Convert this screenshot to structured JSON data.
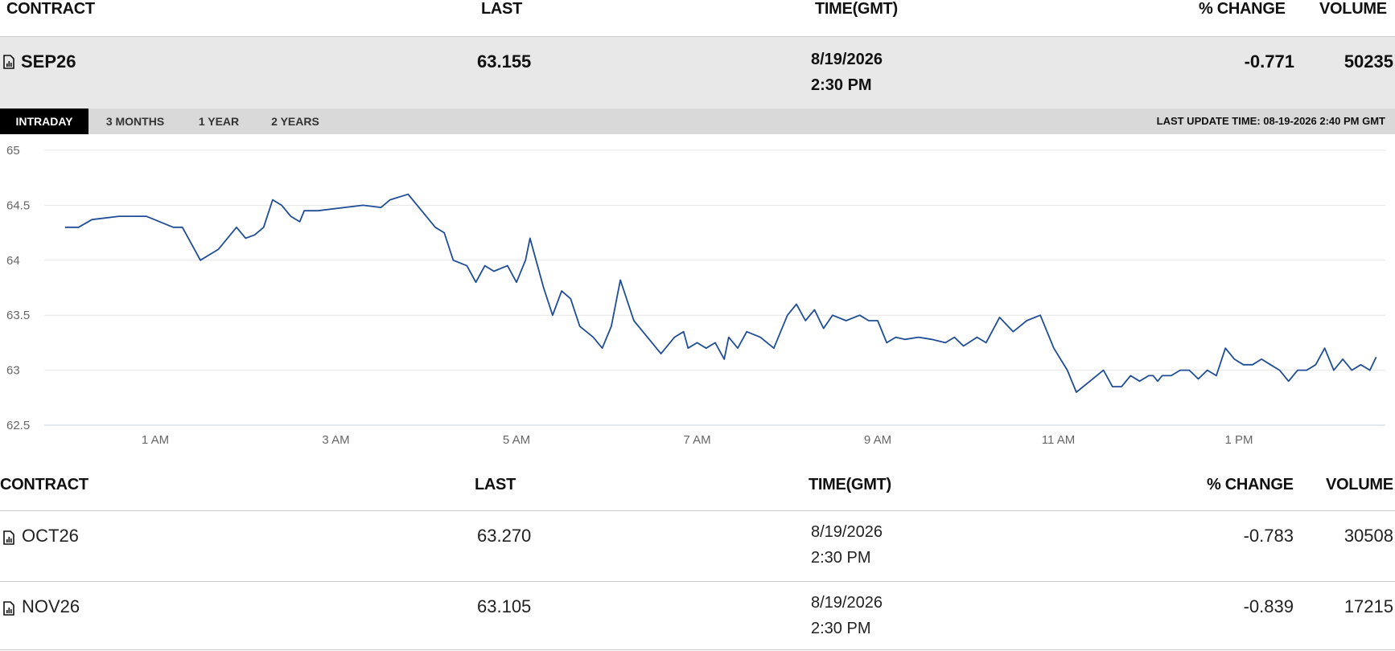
{
  "columns": {
    "contract": "CONTRACT",
    "last": "LAST",
    "time": "TIME(GMT)",
    "change": "% CHANGE",
    "volume": "VOLUME"
  },
  "main": {
    "contract": "SEP26",
    "last": "63.155",
    "date": "8/19/2026",
    "time": "2:30 PM",
    "change": "-0.771",
    "volume": "50235"
  },
  "tabs": [
    "INTRADAY",
    "3 MONTHS",
    "1 YEAR",
    "2 YEARS"
  ],
  "active_tab": "INTRADAY",
  "last_update": "LAST UPDATE TIME: 08-19-2026 2:40 PM GMT",
  "colors": {
    "line": "#1f4e96",
    "tab_active_bg": "#000000",
    "row_bg": "#e8e8e8"
  },
  "chart_data": {
    "type": "line",
    "title": "",
    "xlabel": "",
    "ylabel": "",
    "ylim": [
      62.5,
      65
    ],
    "yticks": [
      "65",
      "64.5",
      "64",
      "63.5",
      "63",
      "62.5"
    ],
    "xticks": [
      "1 AM",
      "3 AM",
      "5 AM",
      "7 AM",
      "9 AM",
      "11 AM",
      "1 PM"
    ],
    "xtick_hours": [
      1,
      3,
      5,
      7,
      9,
      11,
      13
    ],
    "grid": true,
    "series": [
      {
        "x": [
          0.0,
          0.15,
          0.3,
          0.6,
          0.9,
          1.2,
          1.3,
          1.5,
          1.7,
          1.8,
          1.9,
          2.0,
          2.1,
          2.2,
          2.3,
          2.4,
          2.5,
          2.6,
          2.65,
          2.8,
          3.3,
          3.5,
          3.6,
          3.8,
          4.0,
          4.1,
          4.2,
          4.3,
          4.45,
          4.55,
          4.65,
          4.75,
          4.9,
          5.0,
          5.1,
          5.15,
          5.3,
          5.4,
          5.5,
          5.6,
          5.7,
          5.85,
          5.95,
          6.05,
          6.15,
          6.3,
          6.45,
          6.6,
          6.75,
          6.85,
          6.9,
          7.0,
          7.1,
          7.2,
          7.3,
          7.35,
          7.45,
          7.55,
          7.7,
          7.85,
          8.0,
          8.1,
          8.2,
          8.3,
          8.4,
          8.5,
          8.65,
          8.8,
          8.9,
          9.0,
          9.1,
          9.2,
          9.3,
          9.45,
          9.6,
          9.75,
          9.85,
          9.95,
          10.1,
          10.2,
          10.35,
          10.5,
          10.65,
          10.8,
          10.95,
          11.1,
          11.2,
          11.35,
          11.5,
          11.6,
          11.7,
          11.8,
          11.9,
          12.0,
          12.05,
          12.1,
          12.15,
          12.25,
          12.35,
          12.45,
          12.55,
          12.65,
          12.75,
          12.85,
          12.95,
          13.05,
          13.15,
          13.25,
          13.35,
          13.45,
          13.55,
          13.65,
          13.75,
          13.85,
          13.95,
          14.05,
          14.15,
          14.25,
          14.35,
          14.45,
          14.52
        ],
        "y": [
          64.3,
          64.3,
          64.37,
          64.4,
          64.4,
          64.3,
          64.3,
          64.0,
          64.1,
          64.2,
          64.3,
          64.2,
          64.23,
          64.3,
          64.55,
          64.5,
          64.4,
          64.35,
          64.45,
          64.45,
          64.5,
          64.48,
          64.55,
          64.6,
          64.4,
          64.3,
          64.25,
          64.0,
          63.95,
          63.8,
          63.95,
          63.9,
          63.95,
          63.8,
          64.0,
          64.2,
          63.75,
          63.5,
          63.72,
          63.65,
          63.4,
          63.3,
          63.2,
          63.4,
          63.82,
          63.45,
          63.3,
          63.15,
          63.3,
          63.35,
          63.2,
          63.25,
          63.2,
          63.25,
          63.1,
          63.3,
          63.2,
          63.35,
          63.3,
          63.2,
          63.5,
          63.6,
          63.45,
          63.55,
          63.38,
          63.5,
          63.45,
          63.5,
          63.45,
          63.45,
          63.25,
          63.3,
          63.28,
          63.3,
          63.28,
          63.25,
          63.3,
          63.22,
          63.3,
          63.25,
          63.48,
          63.35,
          63.45,
          63.5,
          63.2,
          63.0,
          62.8,
          62.9,
          63.0,
          62.85,
          62.85,
          62.95,
          62.9,
          62.95,
          62.95,
          62.9,
          62.95,
          62.95,
          63.0,
          63.0,
          62.92,
          63.0,
          62.95,
          63.2,
          63.1,
          63.05,
          63.05,
          63.1,
          63.05,
          63.0,
          62.9,
          63.0,
          63.0,
          63.05,
          63.2,
          63.0,
          63.1,
          63.0,
          63.05,
          63.0,
          63.12
        ]
      }
    ]
  },
  "rows": [
    {
      "contract": "OCT26",
      "last": "63.270",
      "date": "8/19/2026",
      "time": "2:30 PM",
      "change": "-0.783",
      "volume": "30508"
    },
    {
      "contract": "NOV26",
      "last": "63.105",
      "date": "8/19/2026",
      "time": "2:30 PM",
      "change": "-0.839",
      "volume": "17215"
    }
  ]
}
